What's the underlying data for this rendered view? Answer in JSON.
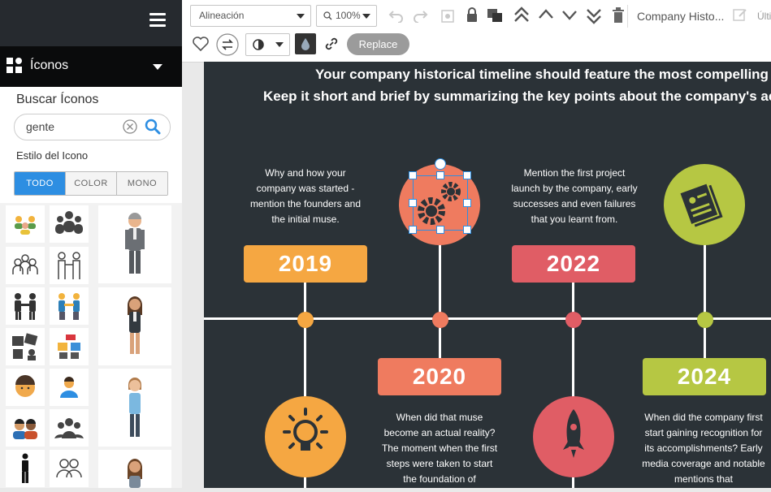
{
  "sidebar": {
    "section_label": "Íconos",
    "search_title": "Buscar Íconos",
    "search_value": "gente",
    "style_title": "Estilo del Icono",
    "style_tabs": [
      "TODO",
      "COLOR",
      "MONO"
    ]
  },
  "toolbar": {
    "align_label": "Alineación",
    "zoom_label": "100%",
    "replace_label": "Replace",
    "doc_title": "Company Histo...",
    "last_save": "Últim"
  },
  "infographic": {
    "intro_line1": "Your company historical timeline should feature the most compelling stories and",
    "intro_line2": "Keep it short and brief by summarizing the key points about the company's achievements (",
    "events": [
      {
        "year": "2019",
        "text": "Why and how your company was started - mention the founders and the initial muse.",
        "color": "#f5a742"
      },
      {
        "year": "2020",
        "text": "When did that muse become an actual reality? The moment when the first steps were taken to start the foundation of",
        "color": "#ef7b5f"
      },
      {
        "year": "2022",
        "text": "Mention the first project launch by the company, early successes and even failures that you learnt from.",
        "color": "#e05d65"
      },
      {
        "year": "2024",
        "text": "When did the company first start gaining recognition for its accomplishments? Early media coverage and notable mentions that",
        "color": "#b6c743"
      }
    ]
  },
  "colors": {
    "canvas_bg": "#2b3237",
    "accent_blue": "#2d8ee2",
    "orange": "#f5a742",
    "salmon": "#ef7b5f",
    "red": "#e05d65",
    "lime": "#b6c743"
  }
}
